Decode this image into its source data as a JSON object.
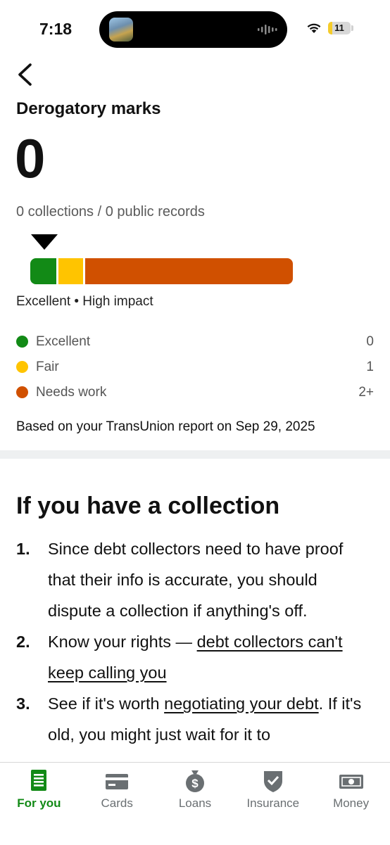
{
  "status_bar": {
    "time": "7:18",
    "battery": "11",
    "battery_level": 0.11
  },
  "header": {
    "title": "Derogatory marks"
  },
  "summary": {
    "count": "0",
    "subtitle": "0 collections / 0 public records",
    "rating_label": "Excellent • High impact"
  },
  "legend": [
    {
      "label": "Excellent",
      "value": "0",
      "color": "#128a16"
    },
    {
      "label": "Fair",
      "value": "1",
      "color": "#ffc400"
    },
    {
      "label": "Needs work",
      "value": "2+",
      "color": "#d05000"
    }
  ],
  "report_note": "Based on your TransUnion report on Sep 29, 2025",
  "collection_section": {
    "title": "If you have a collection",
    "steps": [
      {
        "number": "1.",
        "text": "Since debt collectors need to have proof that their info is accurate, you should dispute a collection if anything's off."
      },
      {
        "number": "2.",
        "text_before": "Know your rights — ",
        "link": "debt collectors can't keep calling you"
      },
      {
        "number": "3.",
        "text_before": "See if it's worth ",
        "link": "negotiating your debt",
        "text_after": ". If it's old, you might just wait for it to"
      }
    ]
  },
  "tab_bar": {
    "tabs": [
      {
        "label": "For you",
        "icon": "document-icon",
        "active": true
      },
      {
        "label": "Cards",
        "icon": "credit-card-icon"
      },
      {
        "label": "Loans",
        "icon": "money-bag-icon"
      },
      {
        "label": "Insurance",
        "icon": "shield-check-icon"
      },
      {
        "label": "Money",
        "icon": "banknote-icon"
      }
    ]
  },
  "colors": {
    "accent": "#128a16",
    "fair": "#ffc400",
    "needs_work": "#d05000",
    "inactive_tab": "#6a6f72"
  }
}
